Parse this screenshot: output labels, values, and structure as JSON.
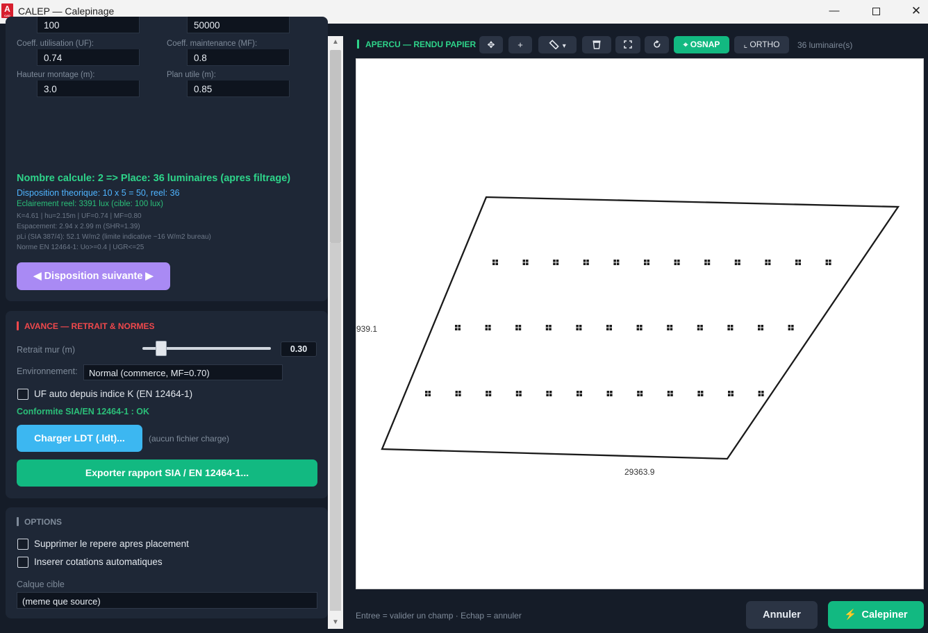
{
  "window": {
    "title": "CALEP — Calepinage",
    "icon_letter": "A",
    "icon_sub": "CAD",
    "minimize": "—",
    "close": "✕"
  },
  "photometry": {
    "partial_values": [
      "100",
      "50000"
    ],
    "uf_label": "Coeff. utilisation (UF):",
    "uf_value": "0.74",
    "mf_label": "Coeff. maintenance (MF):",
    "mf_value": "0.8",
    "height_label": "Hauteur montage (m):",
    "height_value": "3.0",
    "plane_label": "Plan utile (m):",
    "plane_value": "0.85"
  },
  "results": {
    "headline": "Nombre calcule: 2 => Place: 36 luminaires (apres filtrage)",
    "layout": "Disposition theorique: 10 x 5 = 50, reel: 36",
    "illuminance": "Eclairement reel: 3391 lux (cible: 100 lux)",
    "details": [
      "K=4.61 | hu=2.15m | UF=0.74 | MF=0.80",
      "Espacement: 2.94 x 2.99 m (SHR=1.39)",
      "pLi (SIA 387/4): 52.1 W/m2 (limite indicative ~16 W/m2 bureau)",
      "Norme EN 12464-1: Uo>=0.4 | UGR<=25"
    ],
    "next_button": "◀ Disposition suivante ▶"
  },
  "advanced": {
    "title": "AVANCE — RETRAIT & NORMES",
    "accent": "#f0484c",
    "wall_offset_label": "Retrait mur (m)",
    "wall_offset_value": "0.30",
    "wall_offset_fraction": 0.15,
    "env_label": "Environnement:",
    "env_value": "Normal (commerce, MF=0.70)",
    "uf_auto_label": "UF auto depuis indice K (EN 12464-1)",
    "uf_auto_checked": false,
    "compliance": "Conformite SIA/EN 12464-1 : OK",
    "ldt_button": "Charger LDT (.ldt)...",
    "ldt_status": "(aucun fichier charge)",
    "export_button": "Exporter rapport SIA / EN 12464-1..."
  },
  "options": {
    "title": "OPTIONS",
    "accent": "#7f8b9a",
    "remove_marker_label": "Supprimer le repere apres placement",
    "remove_marker_checked": false,
    "auto_dims_label": "Inserer cotations automatiques",
    "auto_dims_checked": false,
    "layer_label": "Calque cible",
    "layer_value": "(meme que source)"
  },
  "preview": {
    "title": "APERCU — RENDU PAPIER",
    "toolbar": {
      "pan": "✥",
      "add": "+",
      "measure": "▾",
      "osnap": "⌖ OSNAP",
      "ortho": "⌞ ORTHO"
    },
    "count": "36 luminaire(s)",
    "dim_left": "939.1",
    "dim_bottom": "29363.9",
    "luminaire_rows": 3,
    "luminaires_per_row": 12
  },
  "footer": {
    "hint": "Entree = valider un champ  ·  Echap = annuler",
    "cancel": "Annuler",
    "run": "Calepiner",
    "run_icon": "⚡"
  },
  "colors": {
    "green": "#12b981",
    "blue": "#3cb7f1",
    "purple": "#a98af4",
    "panel": "#1e2736"
  }
}
